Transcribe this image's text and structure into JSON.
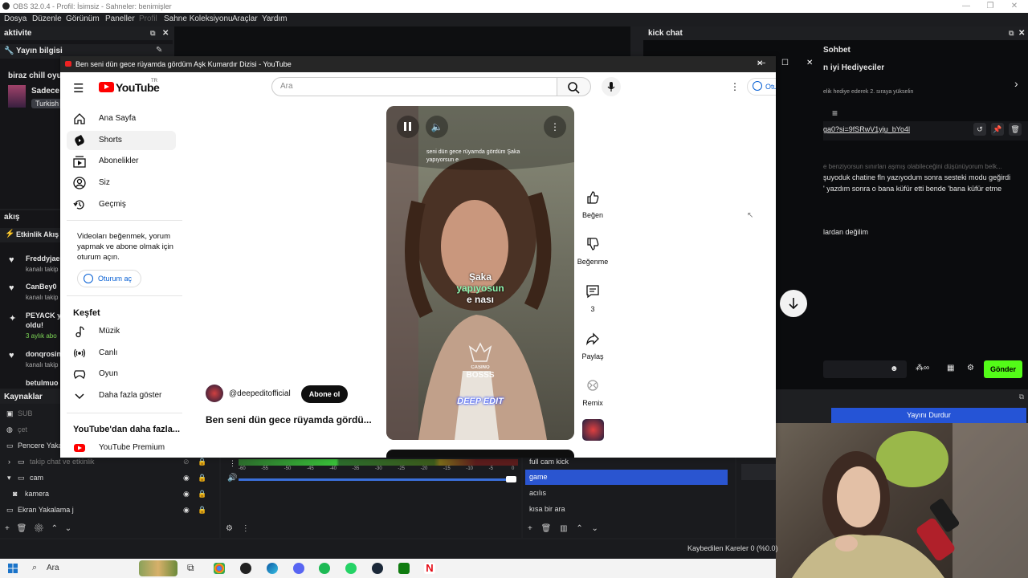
{
  "obs": {
    "title": "OBS 32.0.4 - Profil: İsimsiz - Sahneler: benimişler",
    "menu": [
      "Dosya",
      "Düzenle",
      "Görünüm",
      "Paneller",
      "Profil",
      "Sahne Koleksiyonu",
      "Araçlar",
      "Yardım"
    ],
    "left_dock": {
      "title": "aktivite",
      "stream_info_label": "Yayın bilgisi",
      "stream_title": "biraz chill oyu",
      "category_line1": "Sadece",
      "category_tag": "Turkish"
    },
    "activity": {
      "title": "akış",
      "subtitle": "Etkinlik Akış",
      "events": [
        {
          "name": "Freddyjae",
          "sub": "kanalı takip"
        },
        {
          "name": "CanBey0",
          "sub": "kanalı takip"
        },
        {
          "name": "PEYACK y",
          "name2": "oldu!",
          "sub": "3 aylık abo"
        },
        {
          "name": "donqrosin",
          "sub": "kanalı takip"
        },
        {
          "name": "betulmuo",
          "sub": ""
        }
      ]
    },
    "sources": {
      "title": "Kaynaklar",
      "items": [
        "SUB",
        "çet",
        "Pencere Yaka",
        "takip chat ve etkinlik",
        "cam",
        "kamera",
        "Ekran Yakalama j"
      ]
    },
    "mixer": {
      "ticks": [
        "-60",
        "-55",
        "-50",
        "-45",
        "-40",
        "-35",
        "-30",
        "-25",
        "-20",
        "-15",
        "-10",
        "-5",
        "0"
      ]
    },
    "scenes": {
      "items": [
        "full cam kick",
        "game",
        "acılıs",
        "kısa bir ara"
      ],
      "selected": "game"
    },
    "controls": {
      "stop_stream": "Yayını Durdur"
    },
    "status": {
      "dropped_frames": "Kaybedilen Kareler 0 (%0.0)"
    }
  },
  "chat": {
    "dock_title": "kick chat",
    "header": "Sohbet",
    "gifters_title": "n iyi Hediyeciler",
    "gifters_sub": "elik hediye ederek 2. sıraya yükselin",
    "pinned_link": "ga0?si=9fSRwV1yju_bYo4l",
    "messages": [
      "e benziyorsun sınırları aşmış olabileceğini düşünüyorum belk...",
      "şuyoduk chatine fln yazıyodum sonra sesteki modu geğirdi",
      "' yazdım sonra o bana küfür etti bende 'bana küfür etme",
      "lardan değilim"
    ],
    "send_label": "Gönder"
  },
  "youtube": {
    "window_title": "Ben seni dün gece rüyamda gördüm Aşk Kumardır Dizisi - YouTube",
    "logo_text": "YouTube",
    "logo_country": "TR",
    "search_placeholder": "Ara",
    "sign_in": "Oturum aç",
    "nav": [
      "Ana Sayfa",
      "Shorts",
      "Abonelikler",
      "Siz",
      "Geçmiş"
    ],
    "sign_in_prompt": "Videoları beğenmek, yorum yapmak ve abone olmak için oturum açın.",
    "explore_title": "Keşfet",
    "explore": [
      "Müzik",
      "Canlı",
      "Oyun",
      "Daha fazla göster"
    ],
    "more_title": "YouTube'dan daha fazla...",
    "premium": "YouTube Premium",
    "video": {
      "caption_top": "seni dün gece rüyamda gördüm Şaka yapıyorsun e",
      "subtitle_line1": "Şaka",
      "subtitle_line2": "yapıyosun",
      "subtitle_line3": "e nası",
      "watermark_line1": "CASINO",
      "watermark_line2": "BOSSS",
      "brand": "DEEP EDIT"
    },
    "channel": "@deepeditofficial",
    "subscribe": "Abone ol",
    "video_title": "Ben seni dün gece rüyamda gördü...",
    "actions": {
      "like": "Beğen",
      "dislike": "Beğenme",
      "comments": "3",
      "share": "Paylaş",
      "remix": "Remix"
    }
  },
  "taskbar": {
    "search": "Ara"
  }
}
